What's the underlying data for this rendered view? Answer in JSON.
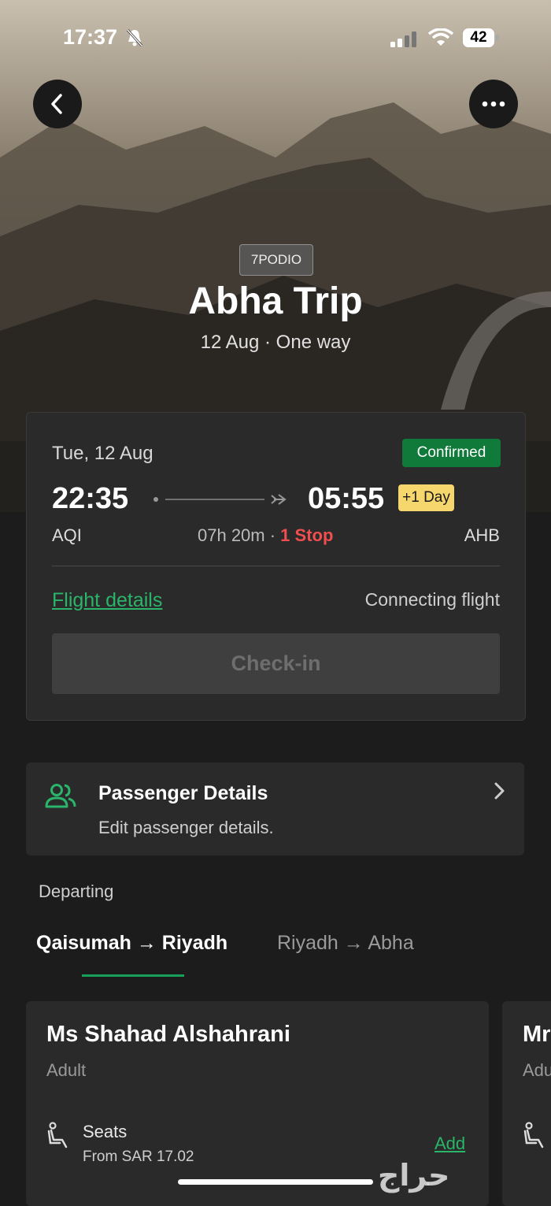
{
  "status_bar": {
    "time": "17:37",
    "battery": "42"
  },
  "hero": {
    "brand": "7PODIO",
    "title": "Abha Trip",
    "subtitle": "12 Aug · One way"
  },
  "flight_card": {
    "date": "Tue, 12 Aug",
    "status": "Confirmed",
    "departure_time": "22:35",
    "arrival_time": "05:55",
    "day_offset": "+1 Day",
    "origin": "AQI",
    "destination": "AHB",
    "duration": "07h 20m · ",
    "stops": "1 Stop",
    "flight_details_link": "Flight details",
    "flight_type": "Connecting flight",
    "checkin_label": "Check-in"
  },
  "passenger_details": {
    "title": "Passenger Details",
    "subtitle": "Edit passenger details."
  },
  "section_label": "Departing",
  "tabs": [
    {
      "label": "Qaisumah → Riyadh",
      "active": true
    },
    {
      "label": "Riyadh → Abha",
      "active": false
    }
  ],
  "passengers": [
    {
      "name": "Ms Shahad Alshahrani",
      "type": "Adult",
      "seats_label": "Seats",
      "seats_price": "From SAR 17.02",
      "add_label": "Add"
    },
    {
      "name": "Mr",
      "type": "Adu"
    }
  ],
  "watermark": "حراج",
  "colors": {
    "confirmed": "#0f7a3a",
    "accent_green": "#2bb56a",
    "stop_red": "#ef4f4f",
    "day_badge": "#f5d76e"
  }
}
